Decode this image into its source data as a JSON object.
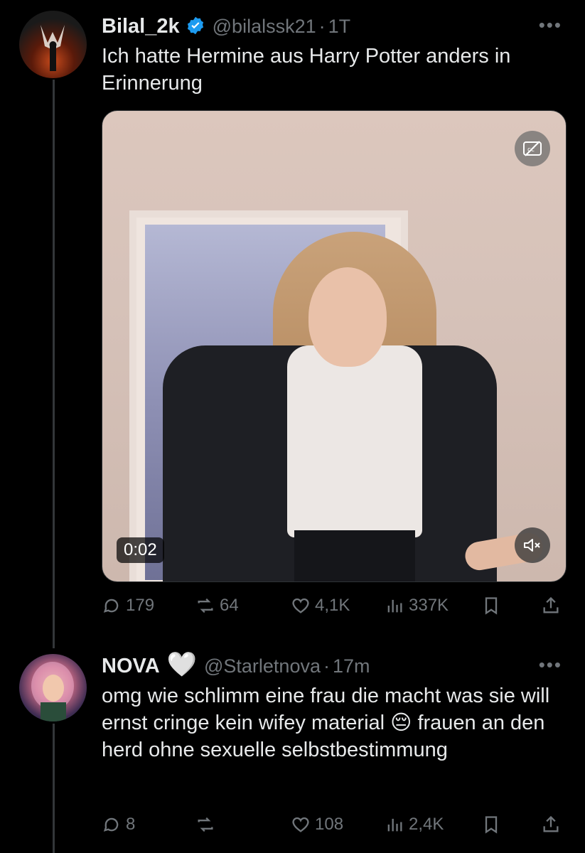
{
  "tweet1": {
    "name": "Bilal_2k",
    "handle": "@bilalssk21",
    "separator": "·",
    "time": "1T",
    "more": "•••",
    "text": "Ich hatte Hermine aus Harry Potter anders in Erinnerung",
    "media": {
      "duration": "0:02",
      "cc_icon": "captions-off-icon",
      "mute_icon": "speaker-muted-icon"
    },
    "stats": {
      "replies": "179",
      "reposts": "64",
      "likes": "4,1K",
      "views": "337K"
    }
  },
  "tweet2": {
    "name": "NOVA",
    "badge": "🤍",
    "handle": "@Starletnova",
    "separator": "·",
    "time": "17m",
    "more": "•••",
    "text": "omg wie schlimm eine frau die macht was sie will ernst cringe kein wifey material 😔 frauen an den herd ohne sexuelle selbstbestimmung",
    "stats": {
      "replies": "8",
      "reposts": "",
      "likes": "108",
      "views": "2,4K"
    }
  },
  "colors": {
    "background": "#000000",
    "text": "#e7e9ea",
    "muted": "#71767b",
    "verified": "#1d9bf0",
    "thread_line": "#333639"
  }
}
